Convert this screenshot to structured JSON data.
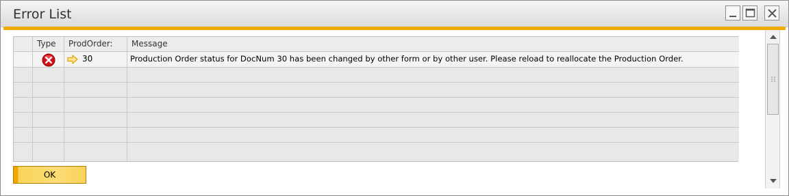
{
  "window": {
    "title": "Error List"
  },
  "grid": {
    "columns": [
      {
        "label": ""
      },
      {
        "label": "Type"
      },
      {
        "label": "ProdOrder:"
      },
      {
        "label": "Message"
      }
    ],
    "rows": [
      {
        "type_icon": "error-icon",
        "prod_order": "30",
        "message": "Production Order status for DocNum 30 has been changed by other form or by other user. Please reload to reallocate the Production Order."
      }
    ]
  },
  "buttons": {
    "ok_label": "OK"
  },
  "colors": {
    "accent": "#f0ab00",
    "error": "#d0101a"
  }
}
